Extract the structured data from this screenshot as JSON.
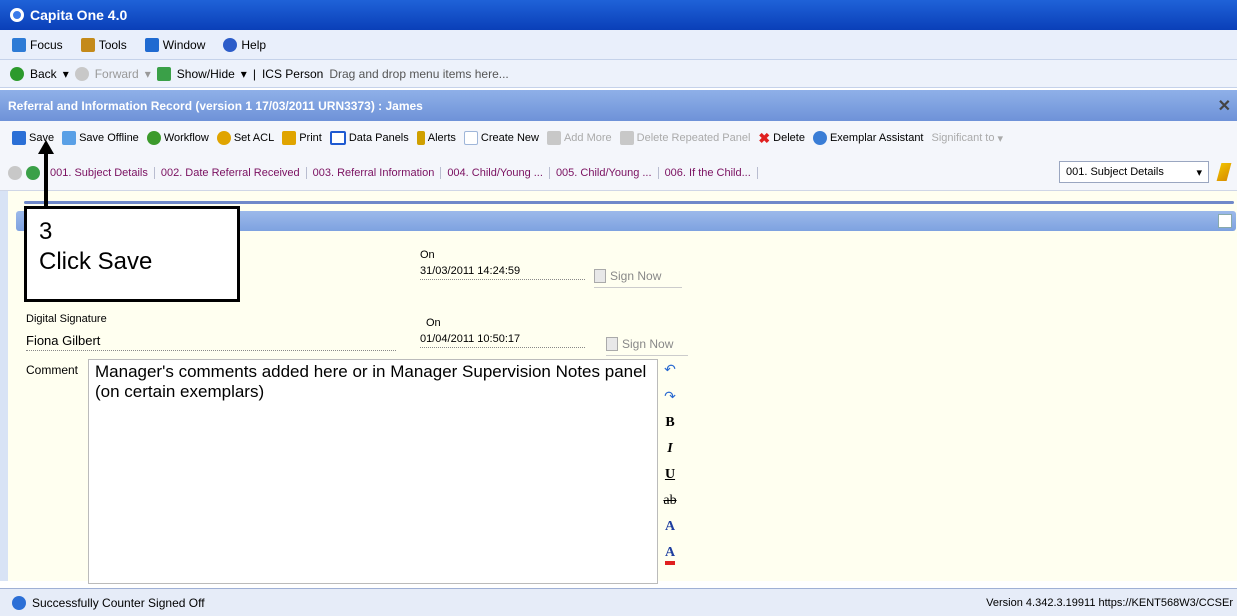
{
  "window": {
    "title": "Capita One 4.0"
  },
  "menu": {
    "items": [
      {
        "label": "Focus",
        "icon": "focus-icon",
        "color": "#2d7bd6"
      },
      {
        "label": "Tools",
        "icon": "tools-icon",
        "color": "#c48a1a"
      },
      {
        "label": "Window",
        "icon": "window-icon",
        "color": "#1f6ad1"
      },
      {
        "label": "Help",
        "icon": "help-icon",
        "color": "#2c5cc9"
      }
    ]
  },
  "nav": {
    "back": "Back",
    "forward": "Forward",
    "show_hide": "Show/Hide",
    "ics_person": "ICS Person",
    "hint": "Drag and drop menu items here..."
  },
  "document": {
    "title": "Referral and Information Record (version 1 17/03/2011 URN3373) : James"
  },
  "toolbar": {
    "buttons": [
      {
        "label": "Save",
        "icon": "save-icon",
        "color": "#2b6fd6",
        "enabled": true
      },
      {
        "label": "Save Offline",
        "icon": "save-offline-icon",
        "color": "#5aa0e6",
        "enabled": true
      },
      {
        "label": "Workflow",
        "icon": "workflow-icon",
        "color": "#3c9a2c",
        "enabled": true
      },
      {
        "label": "Set ACL",
        "icon": "lock-icon",
        "color": "#e0a400",
        "enabled": true
      },
      {
        "label": "Print",
        "icon": "print-icon",
        "color": "#e0a400",
        "enabled": true
      },
      {
        "label": "Data Panels",
        "icon": "data-panels-icon",
        "color": "#1f5ad1",
        "enabled": true
      },
      {
        "label": "Alerts",
        "icon": "alerts-icon",
        "color": "#d0a000",
        "enabled": true
      },
      {
        "label": "Create New",
        "icon": "create-new-icon",
        "color": "#9fb6d9",
        "enabled": true
      },
      {
        "label": "Add More",
        "icon": "add-more-icon",
        "color": "#b0b0b0",
        "enabled": false
      },
      {
        "label": "Delete Repeated Panel",
        "icon": "delete-repeated-icon",
        "color": "#b0b0b0",
        "enabled": false
      },
      {
        "label": "Delete",
        "icon": "delete-icon",
        "color": "#e02020",
        "enabled": true
      },
      {
        "label": "Exemplar Assistant",
        "icon": "exemplar-icon",
        "color": "#3a7dd6",
        "enabled": true
      },
      {
        "label": "Significant to",
        "icon": "",
        "color": "#b0b0b0",
        "enabled": false
      }
    ]
  },
  "tabs": {
    "items": [
      "001. Subject Details",
      "002. Date Referral Received",
      "003. Referral Information",
      "004. Child/Young ...",
      "005. Child/Young ...",
      "006. If the Child..."
    ],
    "selected": "001. Subject Details"
  },
  "form": {
    "on_label": "On",
    "row1": {
      "date": "31/03/2011 14:24:59",
      "sign_label": "Sign Now"
    },
    "row2": {
      "signature_label": "Digital Signature",
      "name": "Fiona Gilbert",
      "date": "01/04/2011 10:50:17",
      "sign_label": "Sign Now"
    },
    "comment_label": "Comment",
    "comment_text": "Manager's comments added here or in Manager Supervision Notes panel (on certain exemplars)",
    "rt_buttons": [
      "B",
      "I",
      "U",
      "ab",
      "A",
      "A"
    ]
  },
  "status": {
    "message": "Successfully Counter Signed Off",
    "version": "Version 4.342.3.19911  https://KENT568W3/CCSEr"
  },
  "callout": {
    "step": "3",
    "text": "Click Save"
  }
}
